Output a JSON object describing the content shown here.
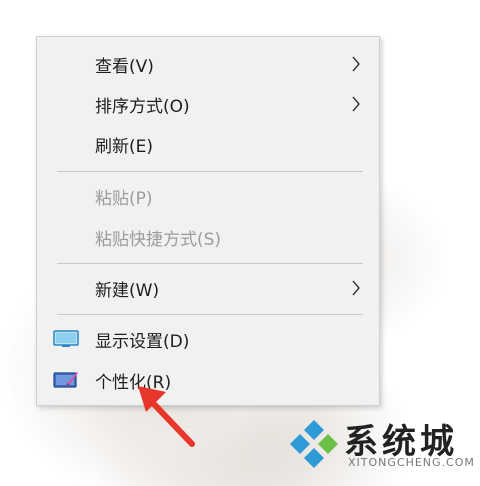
{
  "context_menu": {
    "items": [
      {
        "label": "查看(V)",
        "enabled": true,
        "submenu": true
      },
      {
        "label": "排序方式(O)",
        "enabled": true,
        "submenu": true
      },
      {
        "label": "刷新(E)",
        "enabled": true,
        "submenu": false
      },
      {
        "label": "粘贴(P)",
        "enabled": false,
        "submenu": false
      },
      {
        "label": "粘贴快捷方式(S)",
        "enabled": false,
        "submenu": false
      },
      {
        "label": "新建(W)",
        "enabled": true,
        "submenu": true
      },
      {
        "label": "显示设置(D)",
        "enabled": true,
        "submenu": false,
        "icon": "display-settings-icon"
      },
      {
        "label": "个性化(R)",
        "enabled": true,
        "submenu": false,
        "icon": "personalize-icon"
      }
    ]
  },
  "annotation": {
    "arrow_color": "#e8362b",
    "arrow_target": "个性化(R)"
  },
  "watermark": {
    "brand": "系统城",
    "site": "XITONGCHENG.COM",
    "colors": [
      "#2f9bd6",
      "#6cc04a"
    ]
  }
}
